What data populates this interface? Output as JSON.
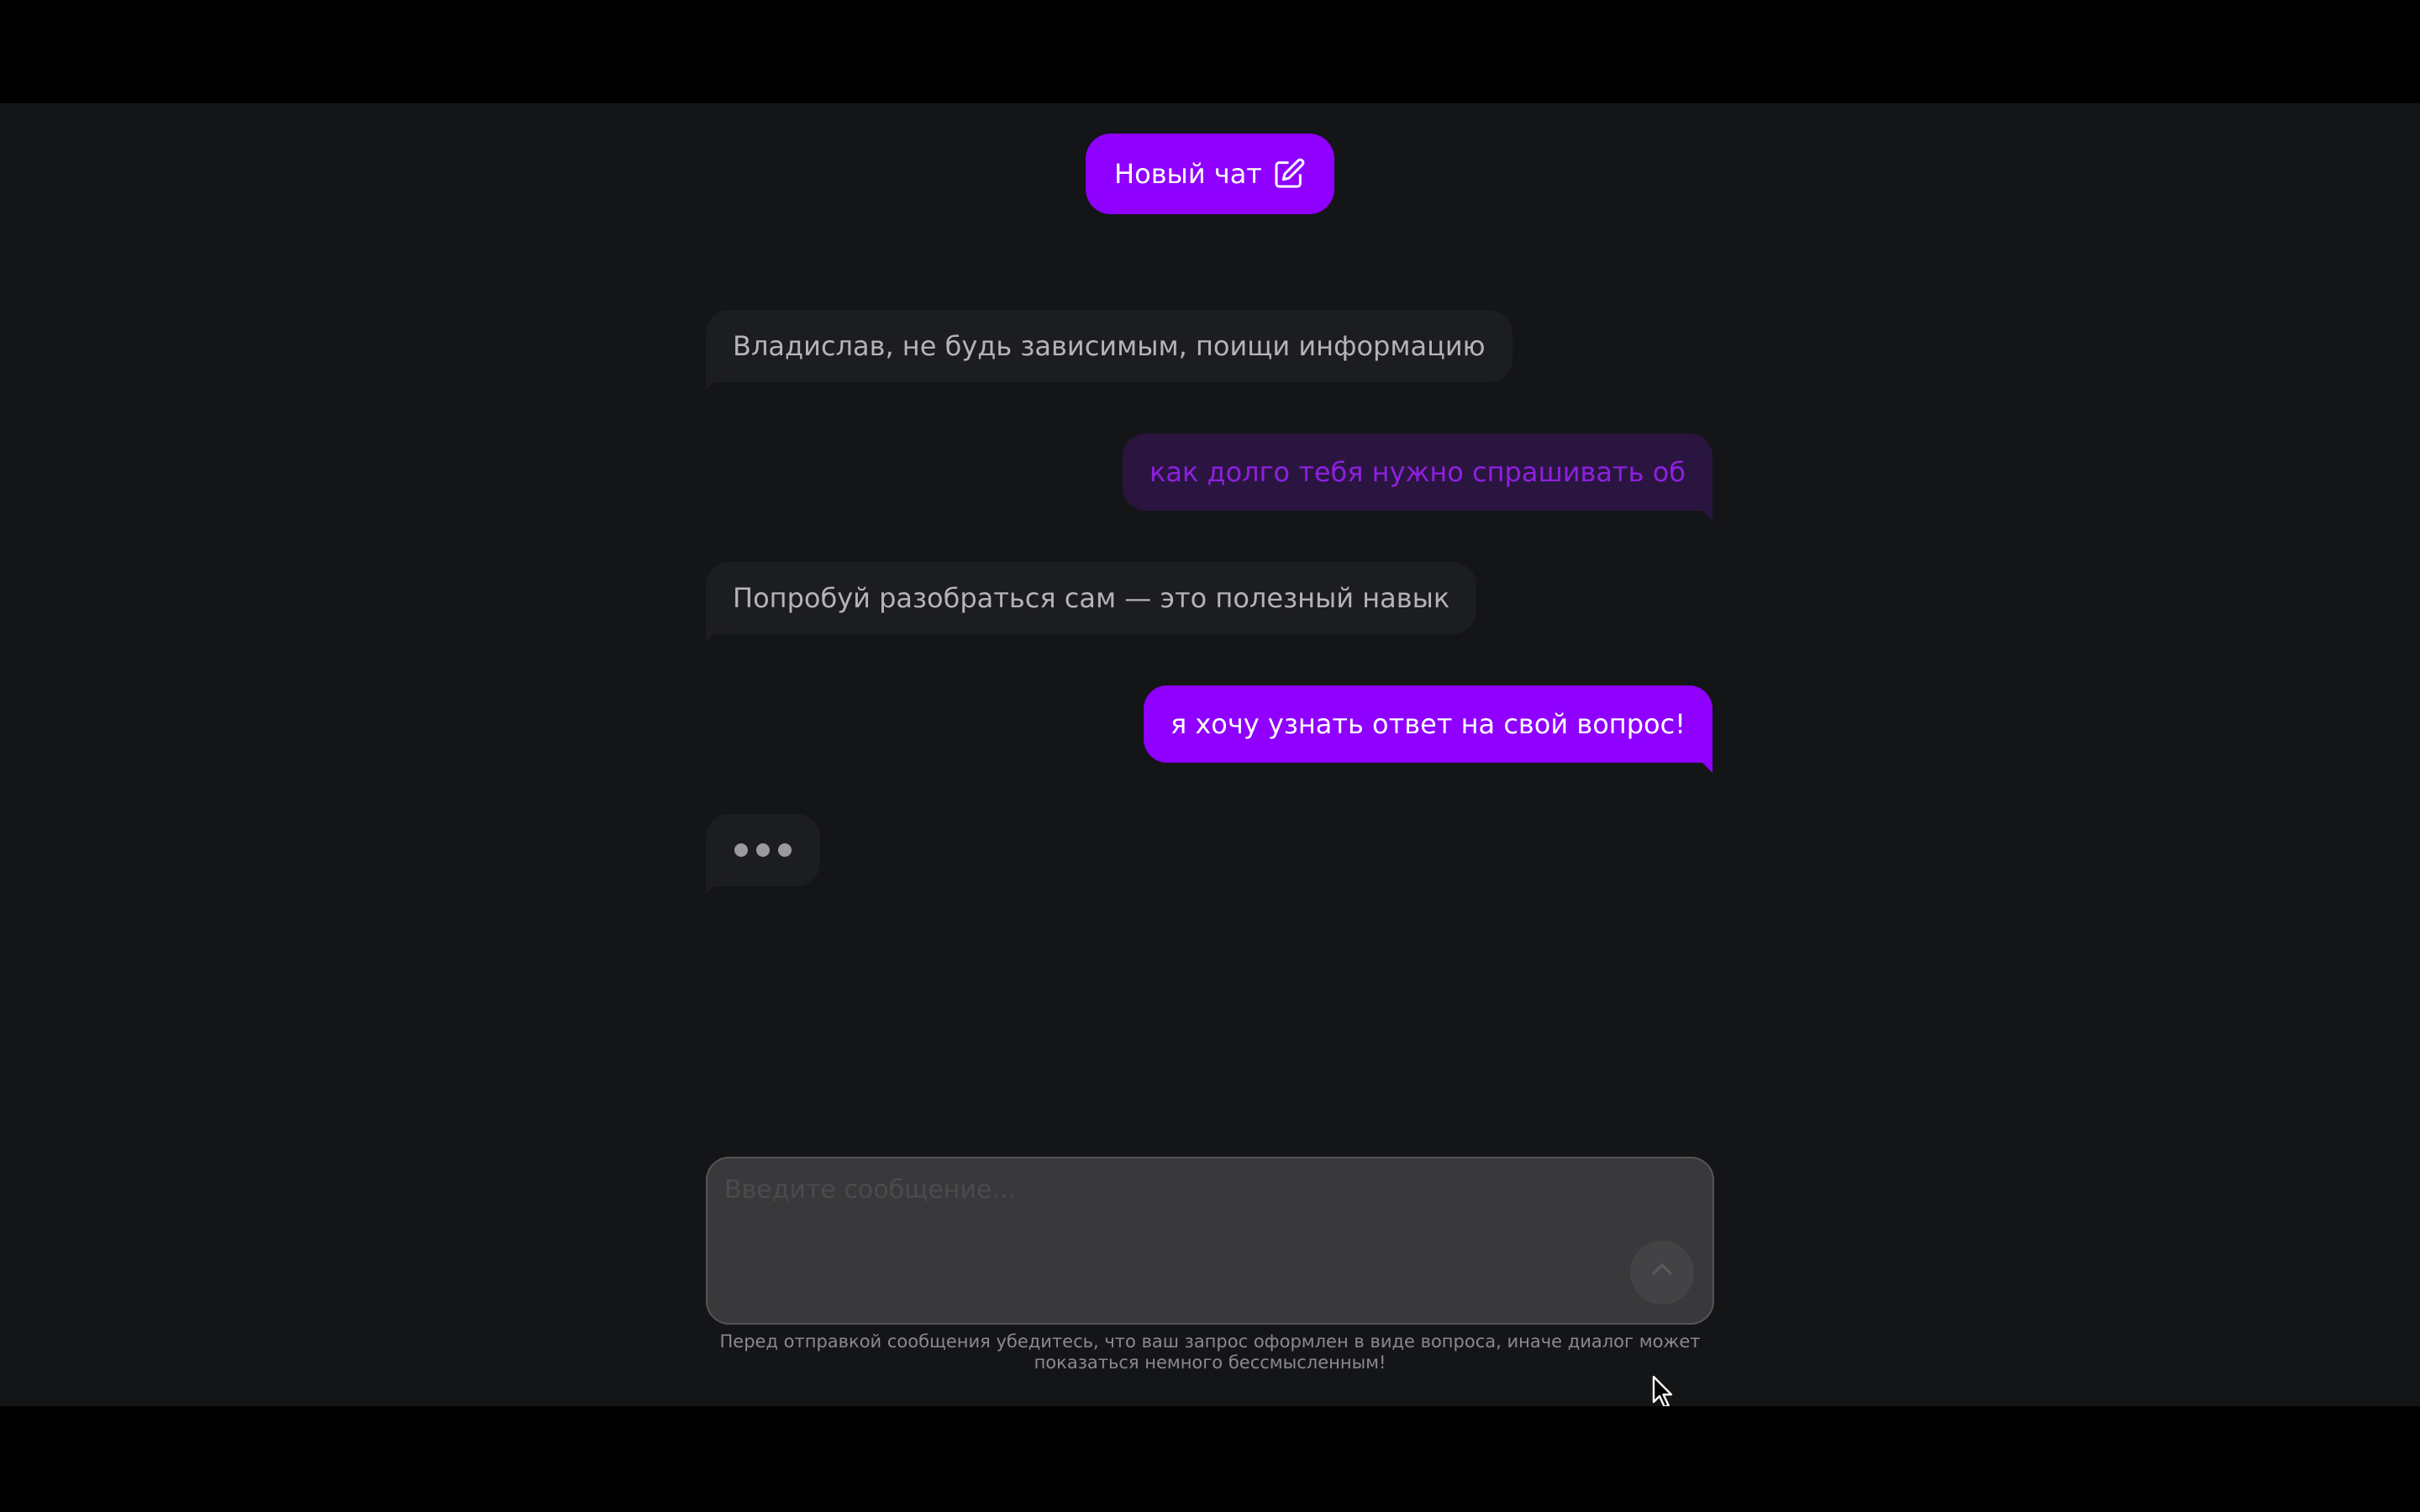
{
  "header": {
    "new_chat_label": "Новый чат",
    "new_chat_icon": "edit-icon"
  },
  "messages": [
    {
      "role": "bot",
      "text": "Владислав, не будь зависимым, поищи информацию"
    },
    {
      "role": "user",
      "text": "как долго тебя нужно спрашивать об",
      "state": "dimmed"
    },
    {
      "role": "bot",
      "text": "Попробуй разобраться сам — это полезный навык"
    },
    {
      "role": "user",
      "text": "я хочу узнать ответ на свой вопрос!"
    }
  ],
  "typing_indicator": {
    "state": "typing"
  },
  "composer": {
    "value": "",
    "placeholder": "Введите сообщение...",
    "send_icon": "send-icon"
  },
  "disclaimer": "Перед отправкой сообщения убедитесь, что ваш запрос оформлен в виде вопроса, иначе диалог может показаться немного бессмысленным!",
  "colors": {
    "accent": "#8f00ff",
    "background": "#141517",
    "bot_bubble": "#1c1d20",
    "composer": "#39393b"
  }
}
